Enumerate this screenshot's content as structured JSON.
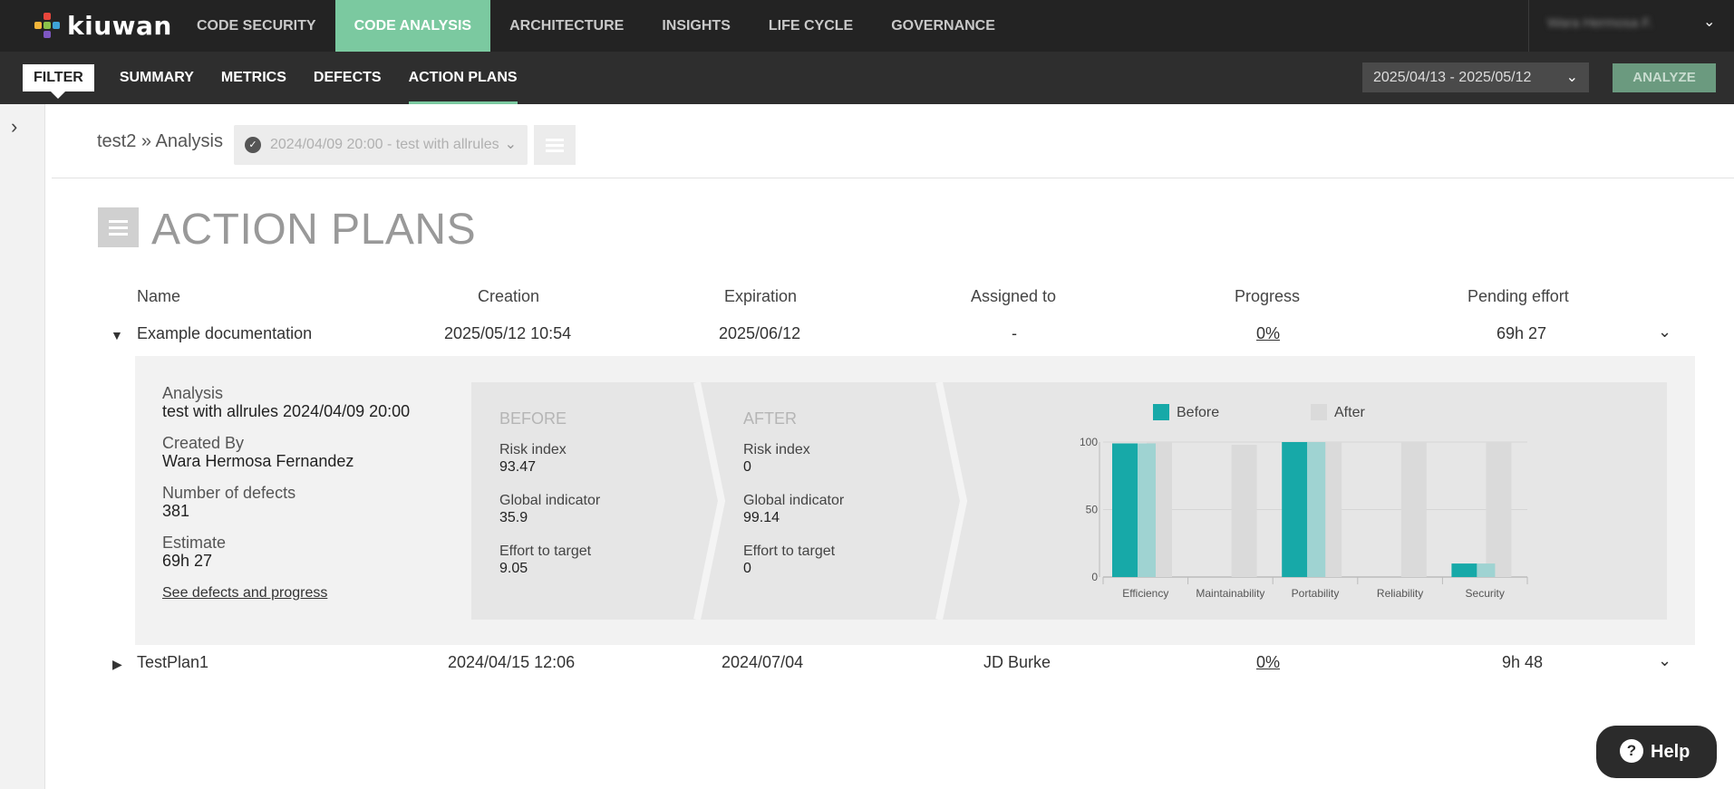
{
  "app": {
    "logo_text": "kiuwan",
    "top_nav": [
      "CODE SECURITY",
      "CODE ANALYSIS",
      "ARCHITECTURE",
      "INSIGHTS",
      "LIFE CYCLE",
      "GOVERNANCE"
    ],
    "active_top_nav": "CODE ANALYSIS",
    "user_name": "Wara Hermosa F."
  },
  "subnav": {
    "items": [
      "FILTER",
      "SUMMARY",
      "METRICS",
      "DEFECTS",
      "ACTION PLANS"
    ],
    "active": "ACTION PLANS",
    "date_range": "2025/04/13 - 2025/05/12",
    "analyze_label": "ANALYZE"
  },
  "breadcrumb": {
    "text": "test2 » Analysis",
    "analysis_selected": "2024/04/09 20:00 - test with allrules"
  },
  "page_title": "ACTION PLANS",
  "table": {
    "headers": [
      "Name",
      "Creation",
      "Expiration",
      "Assigned to",
      "Progress",
      "Pending effort"
    ],
    "rows": [
      {
        "name": "Example documentation",
        "creation": "2025/05/12 10:54",
        "expiration": "2025/06/12",
        "assigned": "-",
        "progress": "0%",
        "effort": "69h 27",
        "expanded": true
      },
      {
        "name": "TestPlan1",
        "creation": "2024/04/15 12:06",
        "expiration": "2024/07/04",
        "assigned": "JD Burke",
        "progress": "0%",
        "effort": "9h 48",
        "expanded": false
      }
    ]
  },
  "detail": {
    "analysis_label": "Analysis",
    "analysis_value": "test with allrules 2024/04/09 20:00",
    "created_by_label": "Created By",
    "created_by_value": "Wara Hermosa Fernandez",
    "defects_label": "Number of defects",
    "defects_value": "381",
    "estimate_label": "Estimate",
    "estimate_value": "69h 27",
    "link": "See defects and progress",
    "before": {
      "title": "BEFORE",
      "risk_label": "Risk index",
      "risk_value": "93.47",
      "gi_label": "Global indicator",
      "gi_value": "35.9",
      "effort_label": "Effort to target",
      "effort_value": "9.05"
    },
    "after": {
      "title": "AFTER",
      "risk_label": "Risk index",
      "risk_value": "0",
      "gi_label": "Global indicator",
      "gi_value": "99.14",
      "effort_label": "Effort to target",
      "effort_value": "0"
    }
  },
  "chart_data": {
    "type": "bar",
    "categories": [
      "Efficiency",
      "Maintainability",
      "Portability",
      "Reliability",
      "Security"
    ],
    "series": [
      {
        "name": "Before",
        "values": [
          99,
          0,
          100,
          0,
          10
        ]
      },
      {
        "name": "After",
        "values": [
          100,
          98,
          100,
          100,
          100
        ]
      }
    ],
    "ylim": [
      0,
      100
    ],
    "yticks": [
      0,
      50,
      100
    ],
    "legend": "top",
    "colors": {
      "before": "#17a9a8",
      "before_light": "#9fd3d2",
      "after": "#dadada"
    }
  },
  "help_label": "Help"
}
